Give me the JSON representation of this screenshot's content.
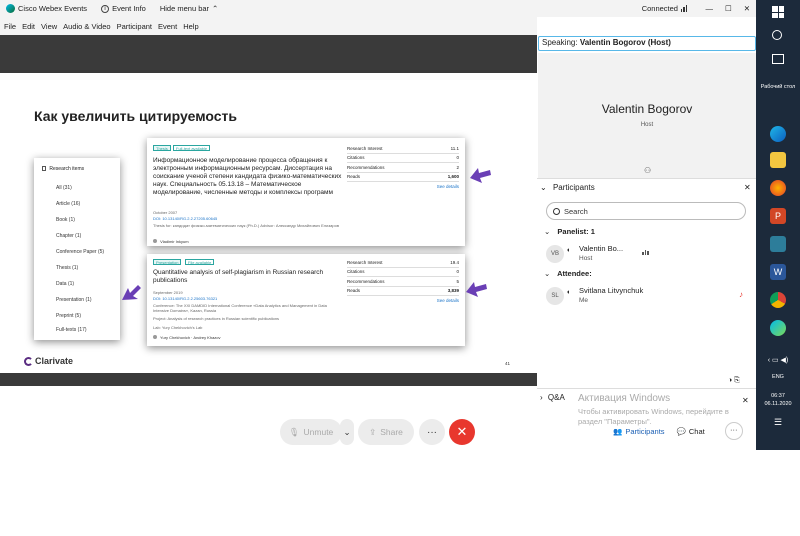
{
  "titlebar": {
    "app_title": "Cisco Webex Events",
    "event_info": "Event Info",
    "hide_menu": "Hide menu bar",
    "status": "Connected"
  },
  "menu": [
    "File",
    "Edit",
    "View",
    "Audio & Video",
    "Participant",
    "Event",
    "Help"
  ],
  "slide": {
    "title": "Как увеличить цитируемость",
    "research_items_head": "Research items",
    "research_items": [
      "All (31)",
      "Article (16)",
      "Book (1)",
      "Chapter (1)",
      "Conference Paper (5)",
      "Thesis (1)",
      "Data (1)",
      "Presentation (1)",
      "Preprint (5)",
      "Full-texts (17)"
    ],
    "card1": {
      "tags": [
        "Thesis",
        "Full-text available"
      ],
      "title": "Информационное моделирование процесса обращения к электронным информационным ресурсам. Диссертация на соискание ученой степени кандидата физико-математических наук. Специальность 05.13.18 – Математическое моделирование, численные методы и комплексы программ",
      "date": "October 2007",
      "doi": "DOI: 10.13140/RG.2.2.27205.60645",
      "meta": "Thesis for: кандидат физико-математических наук (Ph.D.) Advisor: Александр Михайлович Елизаров",
      "author": "Vladimir Inkyum",
      "stats": [
        {
          "label": "Research Interest",
          "value": "11.1"
        },
        {
          "label": "Citations",
          "value": "0"
        },
        {
          "label": "Recommendations",
          "value": "2"
        },
        {
          "label": "Reads",
          "value": "1,600"
        }
      ],
      "see_details": "See details"
    },
    "card2": {
      "tags": [
        "Presentation",
        "File available"
      ],
      "title": "Quantitative analysis of self-plagiarism in Russian research publications",
      "date": "September 2019",
      "doi": "DOI: 10.13140/RG.2.2.25603.76321",
      "meta": "Conference: The XXI DAMDID International Conference «Data Analytics and Management in Data Intensive Domains», Kazan, Russia",
      "project": "Project: Analysis of research practices in Russian scientific publications",
      "lab": "Lab: Yury Chekhovich's Lab",
      "author": "Yury Chekhovich · Andrey Khazov",
      "stats": [
        {
          "label": "Research Interest",
          "value": "19.4"
        },
        {
          "label": "Citations",
          "value": "0"
        },
        {
          "label": "Recommendations",
          "value": "5"
        },
        {
          "label": "Reads",
          "value": "3,839"
        }
      ],
      "see_details": "See details"
    },
    "brand": "Clarivate",
    "page_number": "41"
  },
  "controls": {
    "unmute": "Unmute",
    "share": "Share",
    "more": "···",
    "end": "✕"
  },
  "right": {
    "speaking_label": "Speaking:",
    "speaking_name": "Valentin Bogorov (Host)",
    "video_name": "Valentin Bogorov",
    "video_role": "Host",
    "participants_title": "Participants",
    "search_placeholder": "Search",
    "panelist_head": "Panelist: 1",
    "panelist": {
      "initials": "VB",
      "name": "Valentin Bo...",
      "role": "Host"
    },
    "attendee_head": "Attendee:",
    "attendee": {
      "initials": "SL",
      "name": "Svitlana Litvynchuk",
      "role": "Me"
    },
    "qa_title": "Q&A",
    "watermark_title": "Активация Windows",
    "watermark_text": "Чтобы активировать Windows, перейдите в раздел \"Параметры\".",
    "tab_participants": "Participants",
    "tab_chat": "Chat"
  },
  "taskbar": {
    "desktop_label": "Рабочий стол",
    "lang": "ENG",
    "time": "06:37",
    "date": "06.11.2020"
  },
  "colors": {
    "accent": "#58b8e8",
    "end_call": "#e8372e",
    "arrow": "#6a3fb5",
    "taskbar": "#1c2a3b",
    "teal": "#2aa6a0"
  }
}
